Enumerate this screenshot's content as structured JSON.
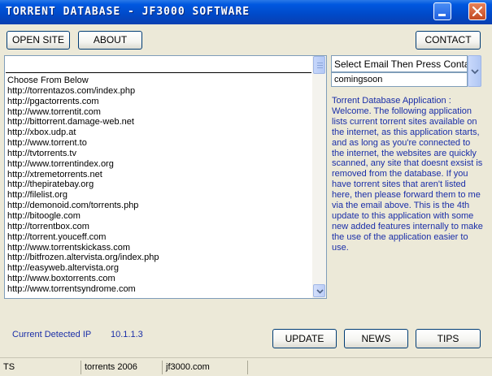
{
  "window": {
    "title": "TORRENT DATABASE - JF3000 SOFTWARE"
  },
  "toolbar": {
    "open_site": "OPEN SITE",
    "about": "ABOUT",
    "contact": "CONTACT"
  },
  "sites": {
    "header": "",
    "items": [
      "Choose From Below",
      "http://torrentazos.com/index.php",
      "http://pgactorrents.com",
      "http://www.torrentit.com",
      "http://bittorrent.damage-web.net",
      "http://xbox.udp.at",
      "http://www.torrent.to",
      "http://tvtorrents.tv",
      "http://www.torrentindex.org",
      "http://xtremetorrents.net",
      "http://thepiratebay.org",
      "http://filelist.org",
      "http://demonoid.com/torrents.php",
      "http://bitoogle.com",
      "http://torrentbox.com",
      "http://torrent.youceff.com",
      "http://www.torrentskickass.com",
      "http://bitfrozen.altervista.org/index.php",
      "http://easyweb.altervista.org",
      "http://www.boxtorrents.com",
      "http://www.torrentsyndrome.com"
    ]
  },
  "email": {
    "label": "Select Email Then Press Contact",
    "value": "comingsoon"
  },
  "description": "Torrent Database Application : Welcome. The following application lists current torrent sites available on the internet, as this application starts, and as long as you're connected to the internet, the websites are quickly scanned, any site that doesnt exsist is removed from the database. If you have torrent sites that aren't listed here, then please forward them to me via the email above. This is the 4th update to this application with some new added features internally to make the use of the application easier to use.",
  "ip": {
    "label": "Current Detected IP",
    "value": "10.1.1.3"
  },
  "bottom_buttons": {
    "update": "UPDATE",
    "news": "NEWS",
    "tips": "TIPS"
  },
  "status": {
    "panel1": "TS",
    "panel2": "torrents 2006",
    "panel3": "jf3000.com",
    "panel4": ""
  },
  "colors": {
    "title_bar": "#0054e3",
    "accent_text": "#1a2ea8",
    "window_bg": "#ece9d8"
  },
  "icons": [
    "minimize-icon",
    "close-icon",
    "scroll-down-arrow-icon",
    "dropdown-arrow-icon"
  ]
}
